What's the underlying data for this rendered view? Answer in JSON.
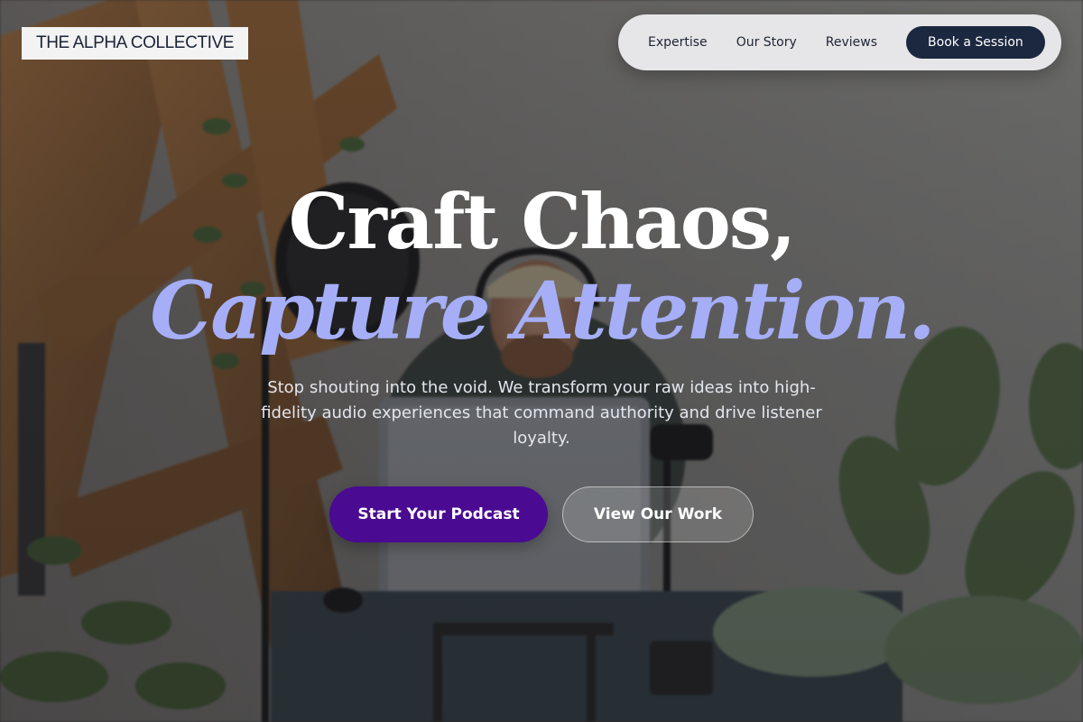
{
  "brand": {
    "logo_text": "THE ALPHA COLLECTIVE"
  },
  "nav": {
    "links": [
      {
        "label": "Expertise"
      },
      {
        "label": "Our Story"
      },
      {
        "label": "Reviews"
      }
    ],
    "cta_label": "Book a Session"
  },
  "hero": {
    "headline_line1": "Craft Chaos,",
    "headline_line2": "Capture Attention.",
    "subtitle": "Stop shouting into the void. We transform your raw ideas into high-fidelity audio experiences that command authority and drive listener loyalty.",
    "primary_cta": "Start Your Podcast",
    "secondary_cta": "View Our Work"
  },
  "colors": {
    "accent_headline": "#a5aef7",
    "primary_button": "#4a0a91",
    "nav_button": "#1c2740",
    "nav_background": "#e6e6e8"
  }
}
